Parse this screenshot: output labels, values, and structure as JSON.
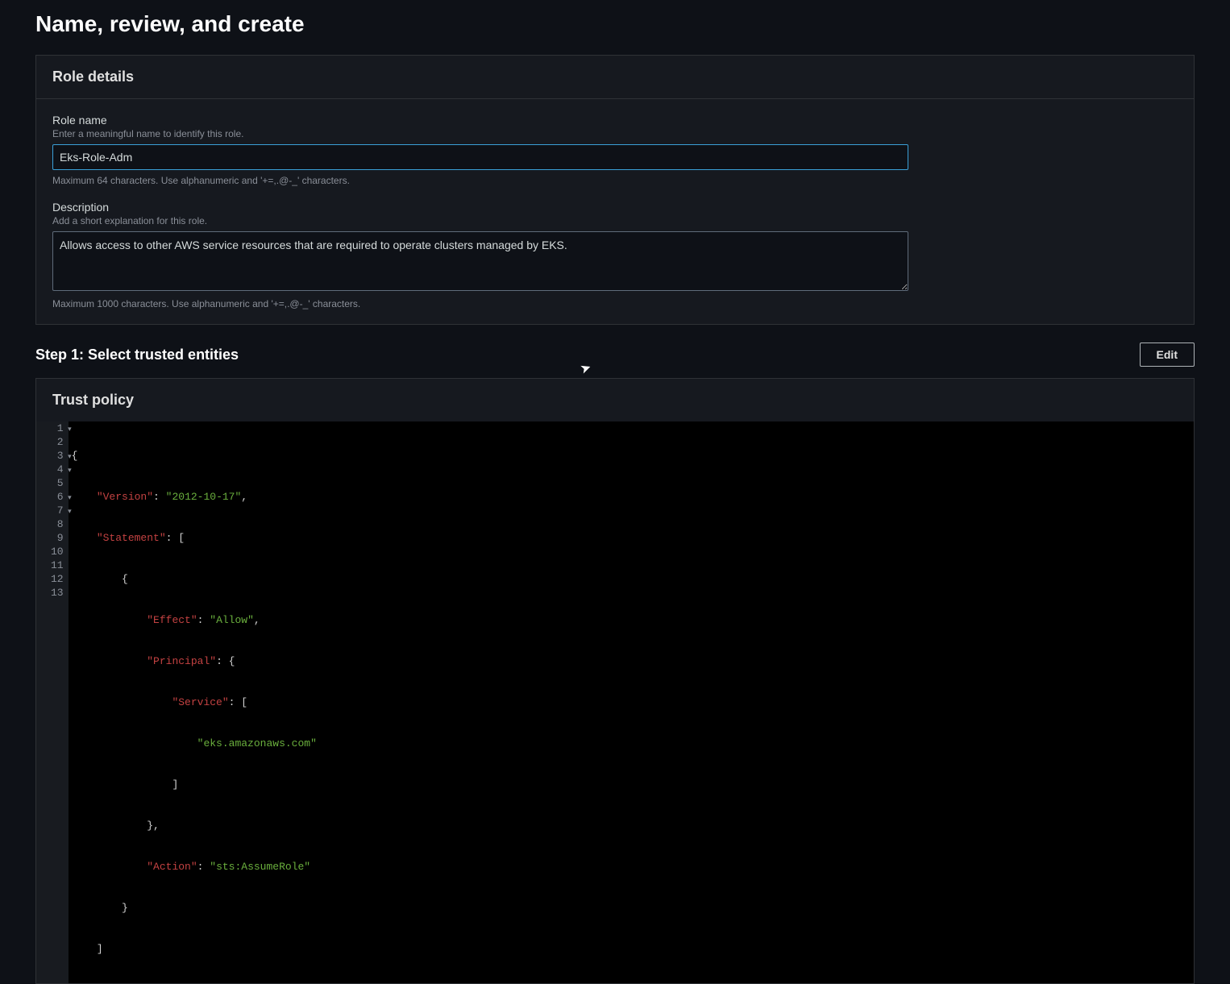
{
  "page": {
    "title": "Name, review, and create"
  },
  "roleDetails": {
    "sectionTitle": "Role details",
    "roleName": {
      "label": "Role name",
      "hint": "Enter a meaningful name to identify this role.",
      "value": "Eks-Role-Adm",
      "constraint": "Maximum 64 characters. Use alphanumeric and '+=,.@-_' characters."
    },
    "description": {
      "label": "Description",
      "hint": "Add a short explanation for this role.",
      "value": "Allows access to other AWS service resources that are required to operate clusters managed by EKS.",
      "constraint": "Maximum 1000 characters. Use alphanumeric and '+=,.@-_' characters."
    }
  },
  "step1": {
    "title": "Step 1: Select trusted entities",
    "editLabel": "Edit"
  },
  "trustPolicy": {
    "sectionTitle": "Trust policy",
    "lineNumbers": [
      "1",
      "2",
      "3",
      "4",
      "5",
      "6",
      "7",
      "8",
      "9",
      "10",
      "11",
      "12",
      "13"
    ],
    "json": {
      "Version": "2012-10-17",
      "Statement": [
        {
          "Effect": "Allow",
          "Principal": {
            "Service": [
              "eks.amazonaws.com"
            ]
          },
          "Action": "sts:AssumeRole"
        }
      ]
    }
  }
}
